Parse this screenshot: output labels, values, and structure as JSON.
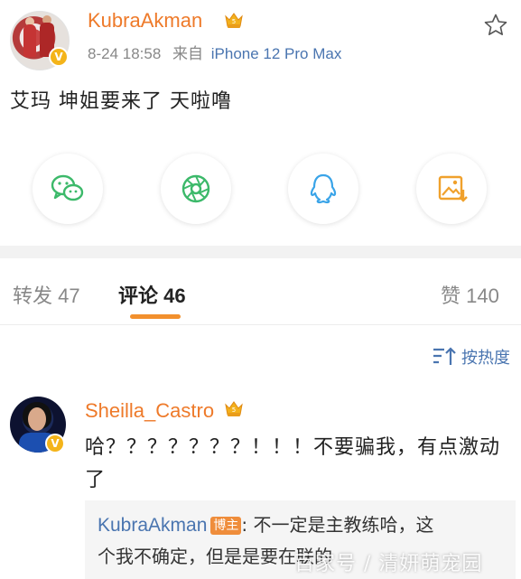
{
  "post": {
    "username": "KubraAkman",
    "level_badge": "V",
    "time": "8-24 18:58",
    "source_prefix": "来自",
    "device": "iPhone 12 Pro Max",
    "text": "艾玛 坤姐要来了 天啦噜"
  },
  "share": {
    "icons": [
      "wechat-icon",
      "moments-icon",
      "qq-icon",
      "save-image-icon"
    ]
  },
  "tabs": {
    "repost": "转发 47",
    "comments": "评论 46",
    "likes": "赞 140"
  },
  "sort": {
    "label": "按热度"
  },
  "comment": {
    "username": "Sheilla_Castro",
    "level_badge": "V",
    "text": "哈？？？？？？？！！！不要骗我，有点激动了",
    "reply": {
      "username": "KubraAkman",
      "op_badge": "博主",
      "line1": ": 不一定是主教练哈，这",
      "line2": "个我不确定，但是是要在联的"
    }
  },
  "watermark": "百家号 / 清妍萌宠园",
  "colors": {
    "username": "#ee7a2a",
    "link": "#4a75b0",
    "accent": "#f2902d",
    "badge": "#f4b41a"
  }
}
